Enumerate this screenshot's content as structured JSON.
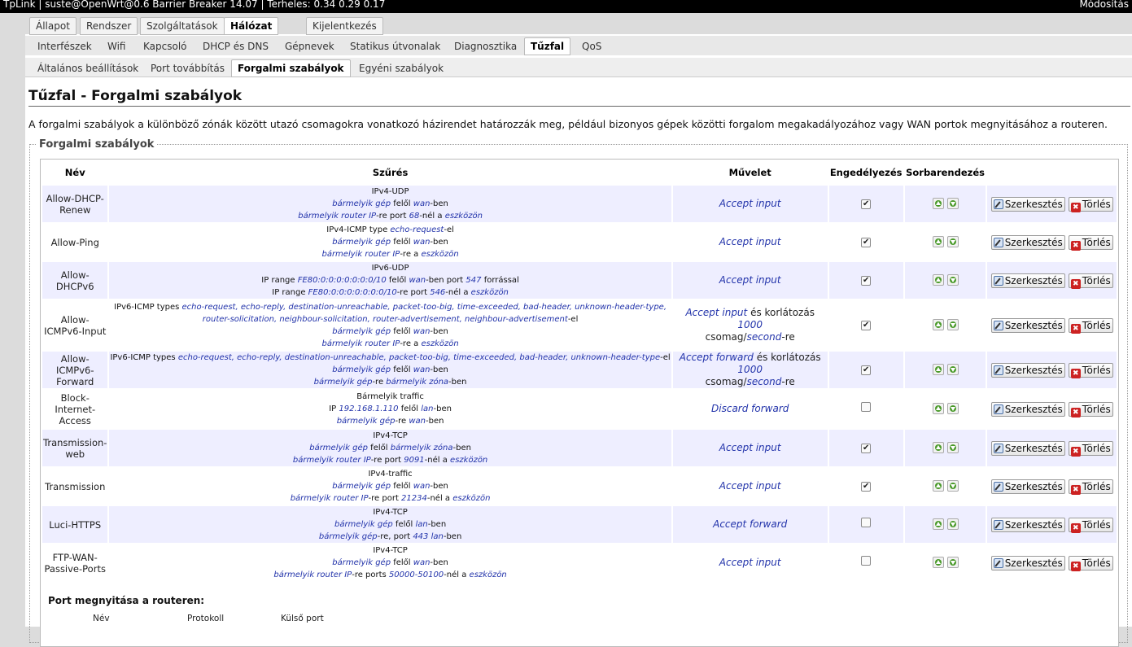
{
  "topbar": {
    "title": "TpLink | suste@OpenWrt@0.6 Barrier Breaker 14.07 | Terheles: 0.34 0.29 0.17",
    "right": "Módosítás"
  },
  "menu1": [
    {
      "label": "Állapot",
      "active": false
    },
    {
      "label": "Rendszer",
      "active": false
    },
    {
      "label": "Szolgáltatások",
      "active": false
    },
    {
      "label": "Hálózat",
      "active": true
    },
    {
      "label": "Kijelentkezés",
      "active": false
    }
  ],
  "menu2": [
    "Interfészek",
    "Wifi",
    "Kapcsoló",
    "DHCP és DNS",
    "Gépnevek",
    "Statikus útvonalak",
    "Diagnosztika",
    "Tűzfal",
    "QoS"
  ],
  "menu2_active": "Tűzfal",
  "menu3": [
    "Általános beállítások",
    "Port továbbítás",
    "Forgalmi szabályok",
    "Egyéni szabályok"
  ],
  "menu3_active": "Forgalmi szabályok",
  "page": {
    "title": "Tűzfal - Forgalmi szabályok",
    "description": "A forgalmi szabályok a különböző zónák között utazó csomagokra vonatkozó házirendet határozzák meg, például bizonyos gépek közötti forgalom megakadályozához vagy WAN portok megnyitásához a routeren.",
    "legend": "Forgalmi szabályok"
  },
  "table": {
    "headers": {
      "name": "Név",
      "filter": "Szűrés",
      "action": "Művelet",
      "enable": "Engedélyezés",
      "sort": "Sorbarendezés",
      "ops": ""
    },
    "edit_label": "Szerkesztés",
    "delete_label": "Törlés",
    "rows": [
      {
        "name": "Allow-DHCP-Renew",
        "enabled": true,
        "filter": [
          [
            [
              "IPv4-UDP",
              0
            ]
          ],
          [
            [
              "bármelyik gép",
              1
            ],
            [
              " felől ",
              0
            ],
            [
              "wan",
              1
            ],
            [
              "-ben",
              0
            ]
          ],
          [
            [
              "bármelyik router IP",
              1
            ],
            [
              "-re port ",
              0
            ],
            [
              "68",
              1
            ],
            [
              "-nél a ",
              0
            ],
            [
              "eszközön",
              1
            ]
          ]
        ],
        "action": [
          [
            [
              "Accept input",
              1
            ]
          ]
        ]
      },
      {
        "name": "Allow-Ping",
        "enabled": true,
        "filter": [
          [
            [
              "IPv4-ICMP type ",
              0
            ],
            [
              "echo-request",
              1
            ],
            [
              "-el",
              0
            ]
          ],
          [
            [
              "bármelyik gép",
              1
            ],
            [
              " felől ",
              0
            ],
            [
              "wan",
              1
            ],
            [
              "-ben",
              0
            ]
          ],
          [
            [
              "bármelyik router IP",
              1
            ],
            [
              "-re a ",
              0
            ],
            [
              "eszközön",
              1
            ]
          ]
        ],
        "action": [
          [
            [
              "Accept input",
              1
            ]
          ]
        ]
      },
      {
        "name": "Allow-DHCPv6",
        "enabled": true,
        "filter": [
          [
            [
              "IPv6-UDP",
              0
            ]
          ],
          [
            [
              "IP range ",
              0
            ],
            [
              "FE80:0:0:0:0:0:0:0/10",
              1
            ],
            [
              " felől ",
              0
            ],
            [
              "wan",
              1
            ],
            [
              "-ben port ",
              0
            ],
            [
              "547",
              1
            ],
            [
              " forrással",
              0
            ]
          ],
          [
            [
              "IP range ",
              0
            ],
            [
              "FE80:0:0:0:0:0:0:0/10",
              1
            ],
            [
              "-re port ",
              0
            ],
            [
              "546",
              1
            ],
            [
              "-nél a ",
              0
            ],
            [
              "eszközön",
              1
            ]
          ]
        ],
        "action": [
          [
            [
              "Accept input",
              1
            ]
          ]
        ]
      },
      {
        "name": "Allow-ICMPv6-Input",
        "enabled": true,
        "filter": [
          [
            [
              "IPv6-ICMP types ",
              0
            ],
            [
              "echo-request, echo-reply, destination-unreachable, packet-too-big, time-exceeded, bad-header, unknown-header-type,",
              1
            ]
          ],
          [
            [
              "router-solicitation, neighbour-solicitation, router-advertisement, neighbour-advertisement",
              1
            ],
            [
              "-el",
              0
            ]
          ],
          [
            [
              "bármelyik gép",
              1
            ],
            [
              " felől ",
              0
            ],
            [
              "wan",
              1
            ],
            [
              "-ben",
              0
            ]
          ],
          [
            [
              "bármelyik router IP",
              1
            ],
            [
              "-re a ",
              0
            ],
            [
              "eszközön",
              1
            ]
          ]
        ],
        "action": [
          [
            [
              "Accept input",
              1
            ],
            [
              " és korlátozás ",
              0
            ],
            [
              "1000",
              1
            ]
          ],
          [
            [
              "csomag/",
              0
            ],
            [
              "second",
              1
            ],
            [
              "-re",
              0
            ]
          ]
        ]
      },
      {
        "name": "Allow-ICMPv6-Forward",
        "enabled": true,
        "filter": [
          [
            [
              "IPv6-ICMP types ",
              0
            ],
            [
              "echo-request, echo-reply, destination-unreachable, packet-too-big, time-exceeded, bad-header, unknown-header-type",
              1
            ],
            [
              "-el",
              0
            ]
          ],
          [
            [
              "bármelyik gép",
              1
            ],
            [
              " felől ",
              0
            ],
            [
              "wan",
              1
            ],
            [
              "-ben",
              0
            ]
          ],
          [
            [
              "bármelyik gép",
              1
            ],
            [
              "-re ",
              0
            ],
            [
              "bármelyik zóna",
              1
            ],
            [
              "-ben",
              0
            ]
          ]
        ],
        "action": [
          [
            [
              "Accept forward",
              1
            ],
            [
              " és korlátozás ",
              0
            ],
            [
              "1000",
              1
            ]
          ],
          [
            [
              "csomag/",
              0
            ],
            [
              "second",
              1
            ],
            [
              "-re",
              0
            ]
          ]
        ]
      },
      {
        "name": "Block-Internet-Access",
        "enabled": false,
        "filter": [
          [
            [
              "Bármelyik traffic",
              0
            ]
          ],
          [
            [
              "IP ",
              0
            ],
            [
              "192.168.1.110",
              1
            ],
            [
              " felől ",
              0
            ],
            [
              "lan",
              1
            ],
            [
              "-ben",
              0
            ]
          ],
          [
            [
              "bármelyik gép",
              1
            ],
            [
              "-re ",
              0
            ],
            [
              "wan",
              1
            ],
            [
              "-ben",
              0
            ]
          ]
        ],
        "action": [
          [
            [
              "Discard forward",
              1
            ]
          ]
        ]
      },
      {
        "name": "Transmission-web",
        "enabled": true,
        "filter": [
          [
            [
              "IPv4-TCP",
              0
            ]
          ],
          [
            [
              "bármelyik gép",
              1
            ],
            [
              " felől ",
              0
            ],
            [
              "bármelyik zóna",
              1
            ],
            [
              "-ben",
              0
            ]
          ],
          [
            [
              "bármelyik router IP",
              1
            ],
            [
              "-re port ",
              0
            ],
            [
              "9091",
              1
            ],
            [
              "-nél a ",
              0
            ],
            [
              "eszközön",
              1
            ]
          ]
        ],
        "action": [
          [
            [
              "Accept input",
              1
            ]
          ]
        ]
      },
      {
        "name": "Transmission",
        "enabled": true,
        "filter": [
          [
            [
              "IPv4-traffic",
              0
            ]
          ],
          [
            [
              "bármelyik gép",
              1
            ],
            [
              " felől ",
              0
            ],
            [
              "wan",
              1
            ],
            [
              "-ben",
              0
            ]
          ],
          [
            [
              "bármelyik router IP",
              1
            ],
            [
              "-re port ",
              0
            ],
            [
              "21234",
              1
            ],
            [
              "-nél a ",
              0
            ],
            [
              "eszközön",
              1
            ]
          ]
        ],
        "action": [
          [
            [
              "Accept input",
              1
            ]
          ]
        ]
      },
      {
        "name": "Luci-HTTPS",
        "enabled": false,
        "filter": [
          [
            [
              "IPv4-TCP",
              0
            ]
          ],
          [
            [
              "bármelyik gép",
              1
            ],
            [
              " felől ",
              0
            ],
            [
              "lan",
              1
            ],
            [
              "-ben",
              0
            ]
          ],
          [
            [
              "bármelyik gép",
              1
            ],
            [
              "-re, port ",
              0
            ],
            [
              "443",
              1
            ],
            [
              " ",
              0
            ],
            [
              "lan",
              1
            ],
            [
              "-ben",
              0
            ]
          ]
        ],
        "action": [
          [
            [
              "Accept forward",
              1
            ]
          ]
        ]
      },
      {
        "name": "FTP-WAN-Passive-Ports",
        "enabled": false,
        "filter": [
          [
            [
              "IPv4-TCP",
              0
            ]
          ],
          [
            [
              "bármelyik gép",
              1
            ],
            [
              " felől ",
              0
            ],
            [
              "wan",
              1
            ],
            [
              "-ben",
              0
            ]
          ],
          [
            [
              "bármelyik router IP",
              1
            ],
            [
              "-re ports ",
              0
            ],
            [
              "50000-50100",
              1
            ],
            [
              "-nél a ",
              0
            ],
            [
              "eszközön",
              1
            ]
          ]
        ],
        "action": [
          [
            [
              "Accept input",
              1
            ]
          ]
        ]
      }
    ]
  },
  "port_section": {
    "title": "Port megnyitása a routeren:",
    "columns": [
      "Név",
      "Protokoll",
      "Külső port"
    ]
  },
  "colors": {
    "link": "#2233aa",
    "odd_row": "#eeeeff"
  }
}
